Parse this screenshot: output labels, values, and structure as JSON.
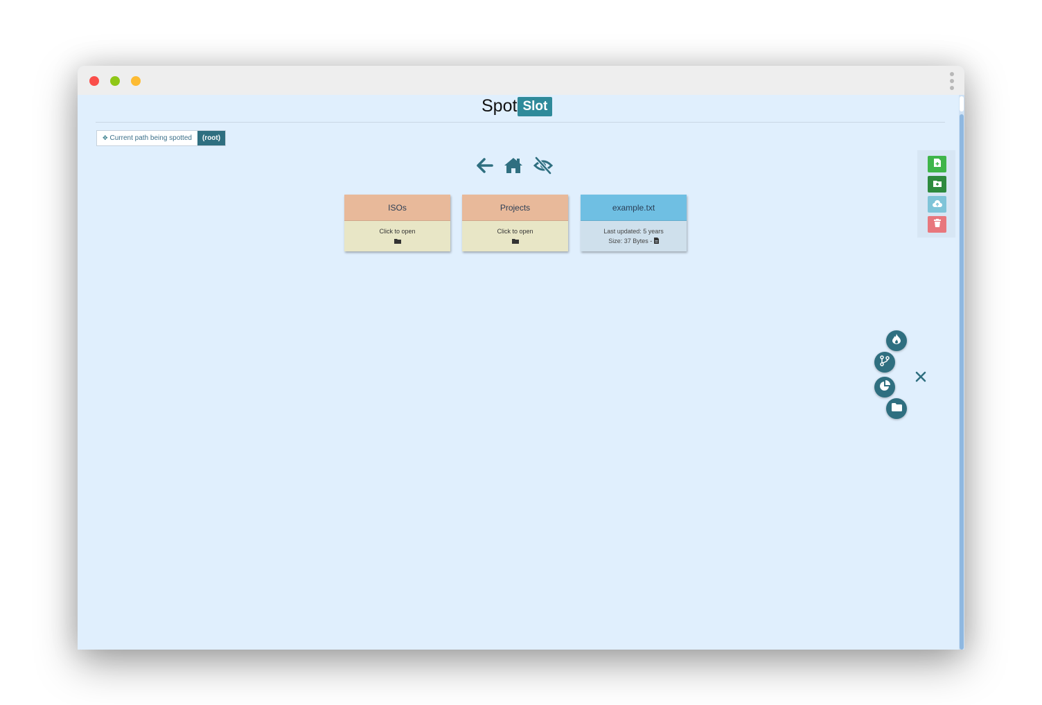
{
  "app": {
    "logo_part1": "Spot",
    "logo_part2": "Slot"
  },
  "path": {
    "label": "Current path being spotted",
    "value": "(root)"
  },
  "nav": {
    "icons": [
      "back-arrow-icon",
      "home-icon",
      "eye-slash-icon"
    ]
  },
  "cards": [
    {
      "type": "folder",
      "name": "ISOs",
      "line1": "Click to open",
      "icon": "folder-icon"
    },
    {
      "type": "folder",
      "name": "Projects",
      "line1": "Click to open",
      "icon": "folder-icon"
    },
    {
      "type": "file",
      "name": "example.txt",
      "line1": "Last updated: 5 years",
      "line2": "Size: 37 Bytes - ",
      "icon": "file-icon"
    }
  ],
  "toolbar": {
    "buttons": [
      "new-file-icon",
      "new-folder-icon",
      "cloud-upload-icon",
      "trash-icon"
    ]
  },
  "fab_menu": {
    "buttons": [
      "fire-icon",
      "git-branch-icon",
      "pie-chart-icon",
      "folder-icon"
    ],
    "close": "close-icon"
  },
  "colors": {
    "accent": "#2f6f80",
    "background": "#e0effd",
    "folder_head": "#e8b99a",
    "file_head": "#6fbfe3"
  }
}
